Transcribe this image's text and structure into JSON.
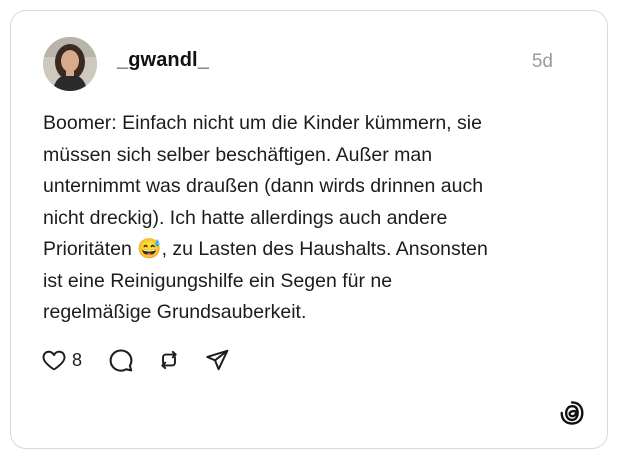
{
  "post": {
    "username": "_gwandl_",
    "timestamp": "5d",
    "text_before_emoji": "Boomer: Einfach nicht um die Kinder kümmern, sie\nmüssen sich selber beschäftigen. Außer man\nunternimmt was draußen (dann wirds drinnen auch\nnicht dreckig). Ich hatte allerdings auch andere\nPrioritäten ",
    "emoji": "😅",
    "text_after_emoji": ", zu Lasten des Haushalts. Ansonsten\nist eine Reinigungshilfe ein Segen für ne\nregelmäßige Grundsauberkeit."
  },
  "actions": {
    "like_count": "8",
    "icons": [
      "heart-icon",
      "comment-icon",
      "repost-icon",
      "share-icon"
    ]
  },
  "branding": {
    "logo": "threads-logo-icon"
  },
  "colors": {
    "border": "#d9d9d9",
    "timestamp": "#9a9a9a",
    "text": "#1c1c1c"
  }
}
